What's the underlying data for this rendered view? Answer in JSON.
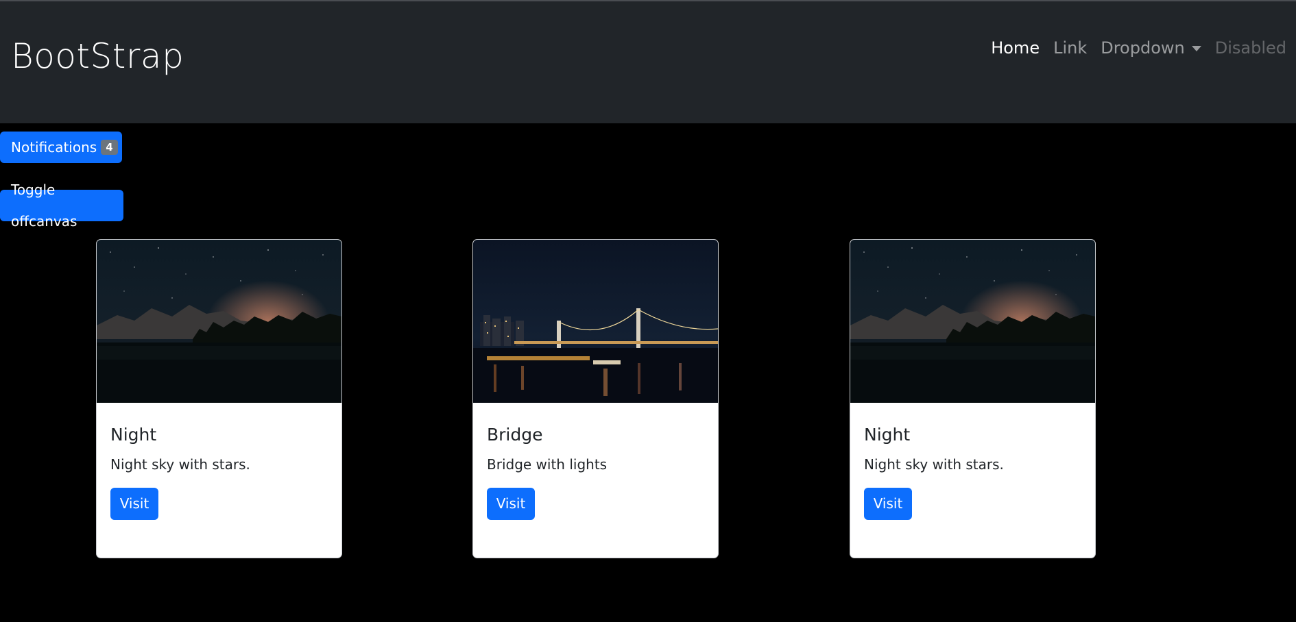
{
  "navbar": {
    "brand": "BootStrap",
    "items": [
      {
        "label": "Home",
        "state": "active"
      },
      {
        "label": "Link",
        "state": "normal"
      },
      {
        "label": "Dropdown",
        "state": "dropdown"
      },
      {
        "label": "Disabled",
        "state": "disabled"
      }
    ]
  },
  "buttons": {
    "notifications_label": "Notifications",
    "notifications_count": "4",
    "toggle_label": "Toggle offcanvas"
  },
  "cards": [
    {
      "title": "Night",
      "text": "Night sky with stars.",
      "button": "Visit",
      "image": "night-sky-mountains"
    },
    {
      "title": "Bridge",
      "text": "Bridge with lights",
      "button": "Visit",
      "image": "city-bridge-night"
    },
    {
      "title": "Night",
      "text": "Night sky with stars.",
      "button": "Visit",
      "image": "night-sky-mountains"
    }
  ],
  "colors": {
    "navbar_bg": "#212529",
    "page_bg": "#000000",
    "primary": "#0d6efd",
    "badge": "#6c757d"
  }
}
